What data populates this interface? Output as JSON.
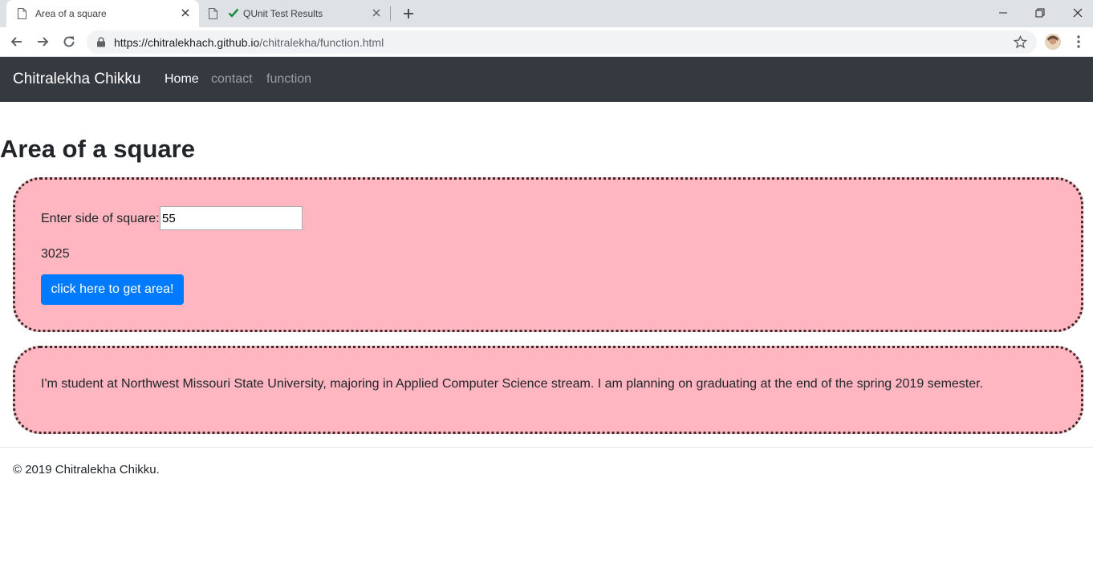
{
  "browser": {
    "tabs": [
      {
        "title": "Area of a square",
        "active": true,
        "icon": "page-icon"
      },
      {
        "title": "QUnit Test Results",
        "active": false,
        "icon": "check-icon"
      }
    ],
    "url_host": "https://chitralekhach.github.io",
    "url_path": "/chitralekha/function.html"
  },
  "navbar": {
    "brand": "Chitralekha Chikku",
    "links": [
      {
        "label": "Home",
        "active": true
      },
      {
        "label": "contact",
        "active": false
      },
      {
        "label": "function",
        "active": false
      }
    ]
  },
  "main": {
    "title": "Area of a square",
    "calc": {
      "label": "Enter side of square:",
      "input_value": "55",
      "result": "3025",
      "button_label": "click here to get area!"
    },
    "about": {
      "text": "I'm student at Northwest Missouri State University, majoring in Applied Computer Science stream. I am planning on graduating at the end of the spring 2019 semester."
    }
  },
  "footer": {
    "text": "© 2019 Chitralekha Chikku."
  },
  "colors": {
    "navbar_bg": "#343a40",
    "panel_bg": "#ffb6c1",
    "button_bg": "#007bff",
    "tab_check": "#1e8e3e"
  }
}
